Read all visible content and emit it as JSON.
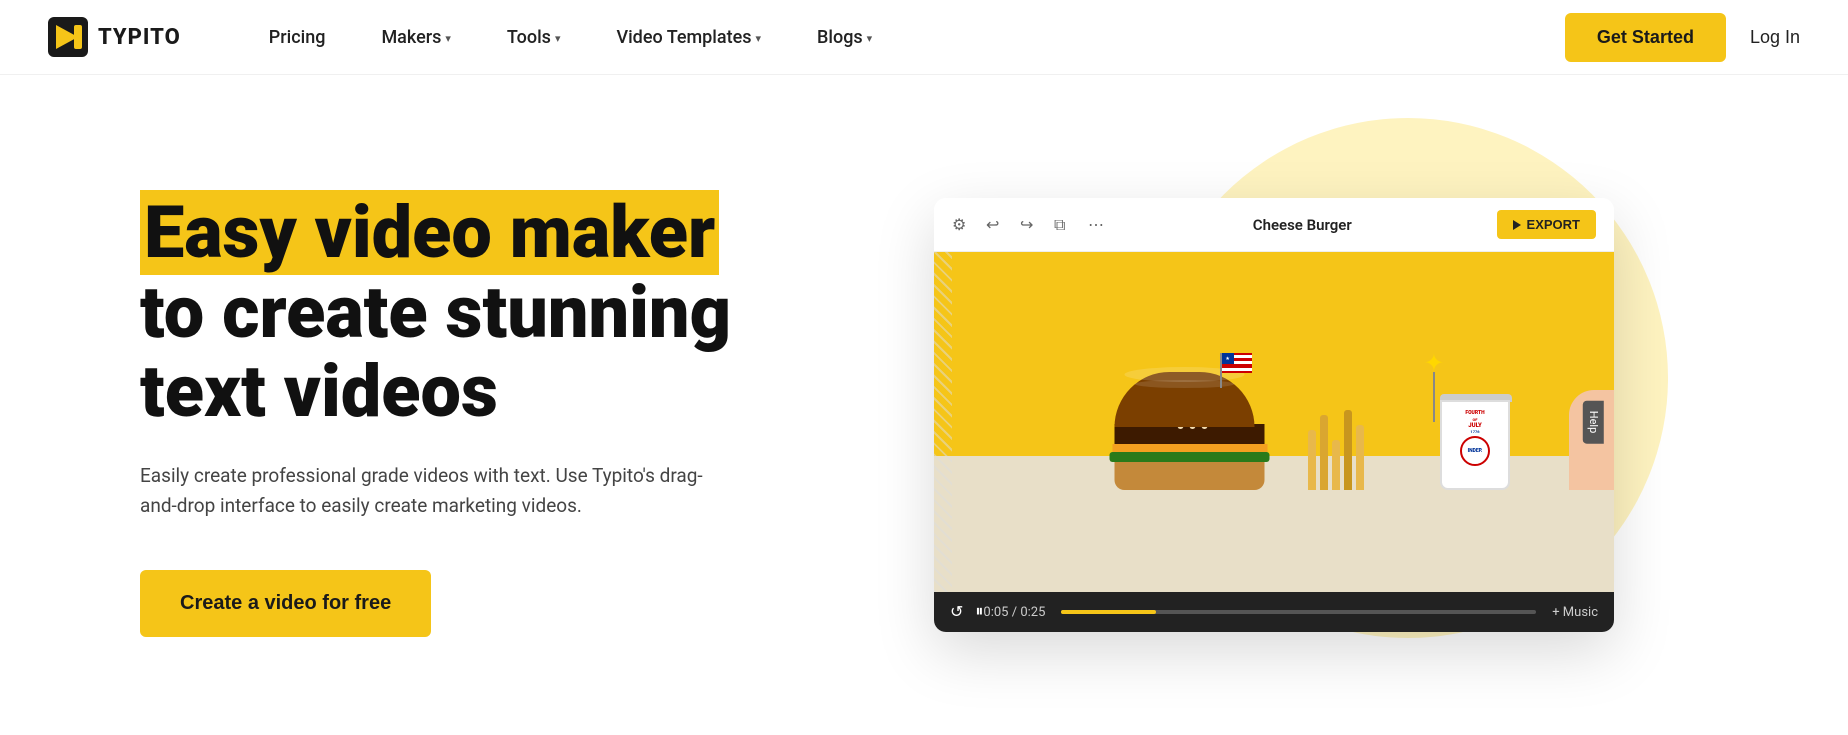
{
  "nav": {
    "logo_text": "TYPITO",
    "links": [
      {
        "label": "Pricing",
        "has_dropdown": false
      },
      {
        "label": "Makers",
        "has_dropdown": true
      },
      {
        "label": "Tools",
        "has_dropdown": true
      },
      {
        "label": "Video Templates",
        "has_dropdown": true
      },
      {
        "label": "Blogs",
        "has_dropdown": true
      }
    ],
    "get_started_label": "Get Started",
    "login_label": "Log In"
  },
  "hero": {
    "headline_part1": "Easy video maker",
    "headline_part2": "to create stunning",
    "headline_part3": "text videos",
    "subtext": "Easily create professional grade videos with text. Use Typito's drag-and-drop interface to easily create marketing videos.",
    "cta_label": "Create a video for free"
  },
  "editor": {
    "title": "Cheese Burger",
    "export_label": "EXPORT",
    "toolbar_icons": [
      "settings",
      "undo",
      "redo",
      "copy",
      "more"
    ],
    "time_current": "0:05",
    "time_total": "0:25",
    "music_label": "+ Music",
    "help_label": "Help"
  },
  "colors": {
    "accent": "#f5c518",
    "bg": "#ffffff",
    "text_dark": "#111111",
    "text_gray": "#444444"
  }
}
